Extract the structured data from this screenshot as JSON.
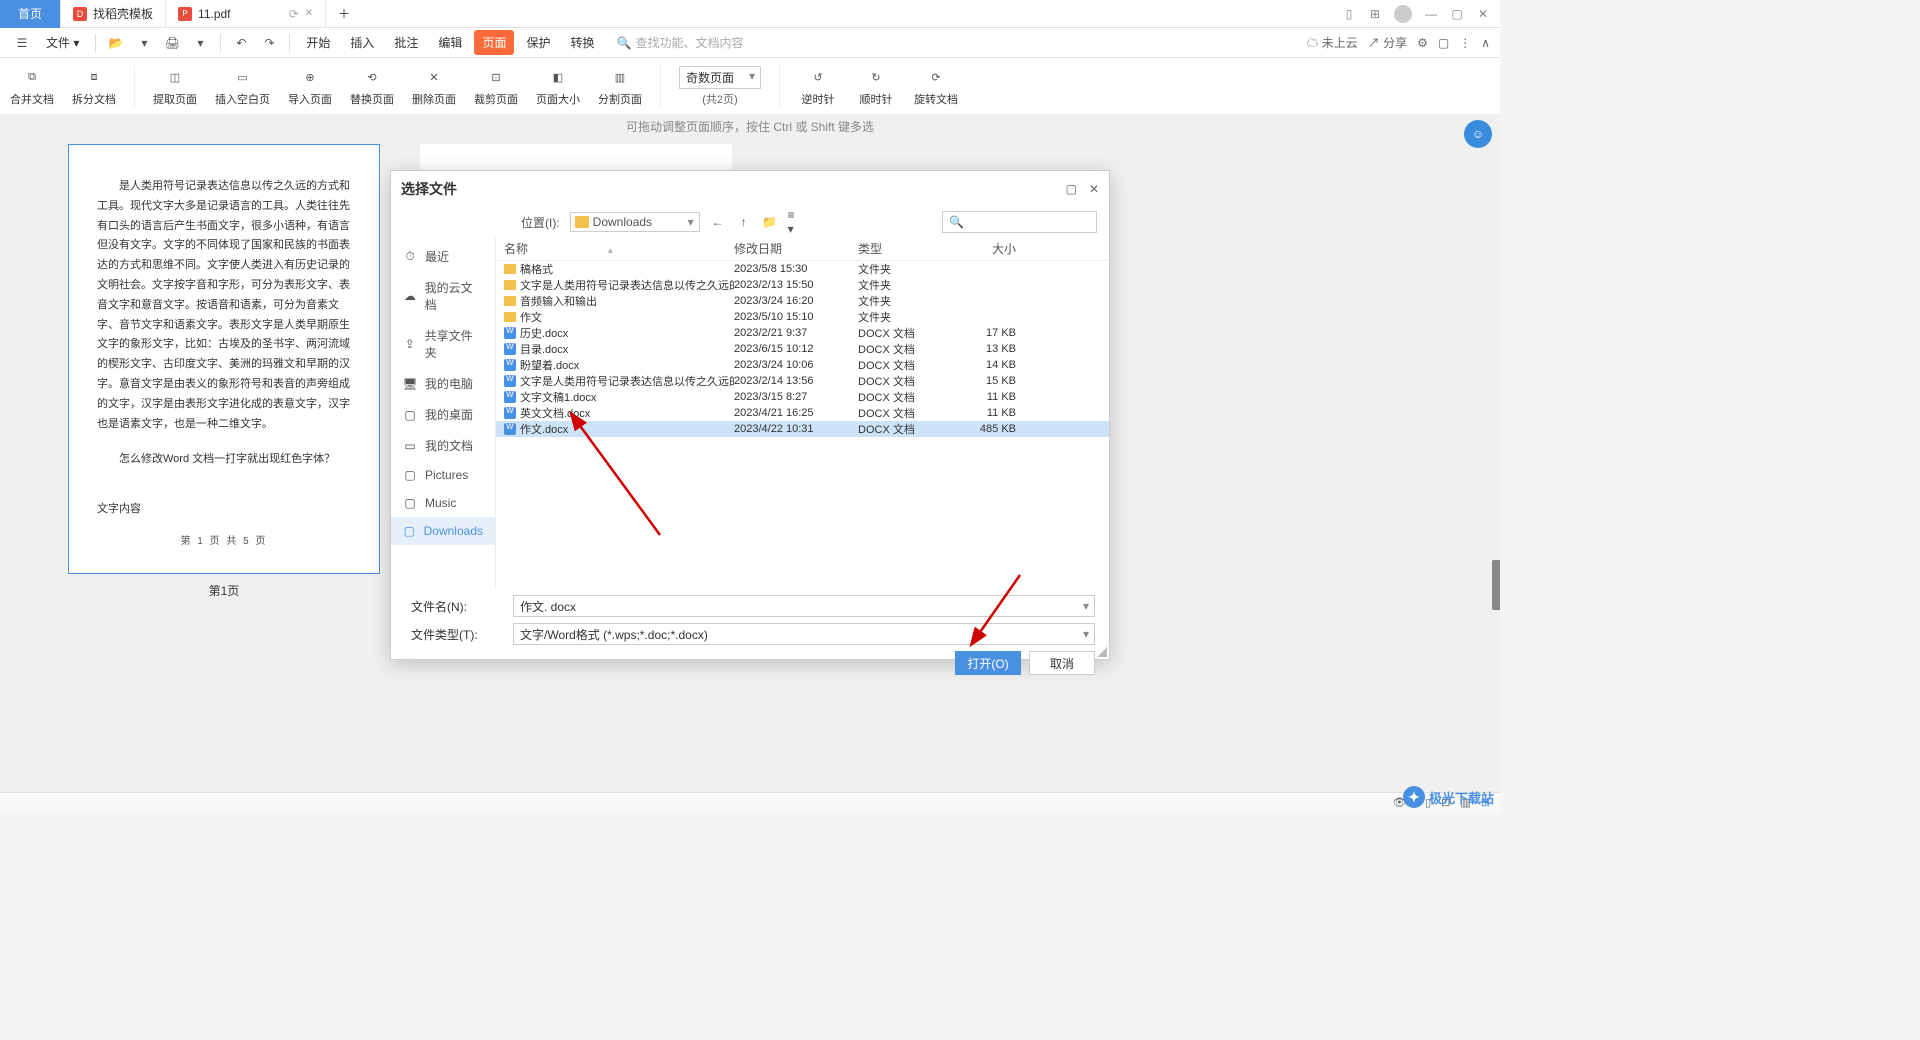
{
  "titlebar": {
    "tabs": [
      {
        "label": "首页",
        "kind": "home"
      },
      {
        "label": "找稻壳模板",
        "kind": "template"
      },
      {
        "label": "11.pdf",
        "kind": "pdf"
      }
    ]
  },
  "menubar": {
    "file_label": "文件",
    "items": [
      "开始",
      "插入",
      "批注",
      "编辑",
      "页面",
      "保护",
      "转换"
    ],
    "active_index": 4,
    "search_placeholder": "查找功能、文档内容"
  },
  "menubar_right": {
    "cloud": "未上云",
    "share": "分享"
  },
  "ribbon": {
    "buttons": [
      "合并文档",
      "拆分文档",
      "提取页面",
      "插入空白页",
      "导入页面",
      "替换页面",
      "删除页面",
      "裁剪页面",
      "页面大小",
      "分割页面"
    ],
    "select_value": "奇数页面",
    "page_count": "(共2页)",
    "rotate": [
      "逆时针",
      "顺时针",
      "旋转文档"
    ]
  },
  "hint": "可拖动调整页面顺序，按住 Ctrl 或 Shift 键多选",
  "page_thumb": {
    "para1": "是人类用符号记录表达信息以传之久远的方式和工具。现代文字大多是记录语言的工具。人类往往先有口头的语言后产生书面文字，很多小语种，有语言但没有文字。文字的不同体现了国家和民族的书面表达的方式和思维不同。文字使人类进入有历史记录的文明社会。文字按字音和字形，可分为表形文字、表音文字和意音文字。按语音和语素，可分为音素文字、音节文字和语素文字。表形文字是人类早期原生文字的象形文字，比如：古埃及的圣书字、两河流域的楔形文字、古印度文字、美洲的玛雅文和早期的汉字。意音文字是由表义的象形符号和表音的声旁组成的文字，汉字是由表形文字进化成的表意文字，汉字也是语素文字，也是一种二维文字。",
    "para2": "怎么修改Word 文档一打字就出现红色字体？",
    "content_label": "文字内容",
    "footer": "第 1 页 共 5 页",
    "page_label": "第1页"
  },
  "dialog": {
    "title": "选择文件",
    "location_label": "位置(I):",
    "location_value": "Downloads",
    "columns": {
      "name": "名称",
      "date": "修改日期",
      "type": "类型",
      "size": "大小"
    },
    "sidebar": [
      {
        "label": "最近",
        "icon": "clock"
      },
      {
        "label": "我的云文档",
        "icon": "cloud"
      },
      {
        "label": "共享文件夹",
        "icon": "share"
      },
      {
        "label": "我的电脑",
        "icon": "computer"
      },
      {
        "label": "我的桌面",
        "icon": "desktop"
      },
      {
        "label": "我的文档",
        "icon": "doc"
      },
      {
        "label": "Pictures",
        "icon": "folder"
      },
      {
        "label": "Music",
        "icon": "folder"
      },
      {
        "label": "Downloads",
        "icon": "folder"
      }
    ],
    "sidebar_active": 8,
    "rows": [
      {
        "name": "稿格式",
        "date": "2023/5/8 15:30",
        "type": "文件夹",
        "size": "",
        "icon": "folder"
      },
      {
        "name": "文字是人类用符号记录表达信息以传之久远的方式...",
        "date": "2023/2/13 15:50",
        "type": "文件夹",
        "size": "",
        "icon": "folder"
      },
      {
        "name": "音频输入和输出",
        "date": "2023/3/24 16:20",
        "type": "文件夹",
        "size": "",
        "icon": "folder"
      },
      {
        "name": "作文",
        "date": "2023/5/10 15:10",
        "type": "文件夹",
        "size": "",
        "icon": "folder"
      },
      {
        "name": "历史.docx",
        "date": "2023/2/21 9:37",
        "type": "DOCX 文档",
        "size": "17 KB",
        "icon": "doc"
      },
      {
        "name": "目录.docx",
        "date": "2023/6/15 10:12",
        "type": "DOCX 文档",
        "size": "13 KB",
        "icon": "doc"
      },
      {
        "name": "盼望着.docx",
        "date": "2023/3/24 10:06",
        "type": "DOCX 文档",
        "size": "14 KB",
        "icon": "doc"
      },
      {
        "name": "文字是人类用符号记录表达信息以传之久远的方...",
        "date": "2023/2/14 13:56",
        "type": "DOCX 文档",
        "size": "15 KB",
        "icon": "doc"
      },
      {
        "name": "文字文稿1.docx",
        "date": "2023/3/15 8:27",
        "type": "DOCX 文档",
        "size": "11 KB",
        "icon": "doc"
      },
      {
        "name": "英文文档.docx",
        "date": "2023/4/21 16:25",
        "type": "DOCX 文档",
        "size": "11 KB",
        "icon": "doc"
      },
      {
        "name": "作文.docx",
        "date": "2023/4/22 10:31",
        "type": "DOCX 文档",
        "size": "485 KB",
        "icon": "doc"
      }
    ],
    "selected_row": 10,
    "filename_label": "文件名(N):",
    "filename_value": "作文. docx",
    "filetype_label": "文件类型(T):",
    "filetype_value": "文字/Word格式 (*.wps;*.doc;*.docx)",
    "open_btn": "打开(O)",
    "cancel_btn": "取消"
  },
  "watermark": {
    "text": "极光下载站"
  },
  "colors": {
    "accent": "#4a90e2",
    "orange": "#fd6b3c",
    "arrow": "#d00000"
  }
}
